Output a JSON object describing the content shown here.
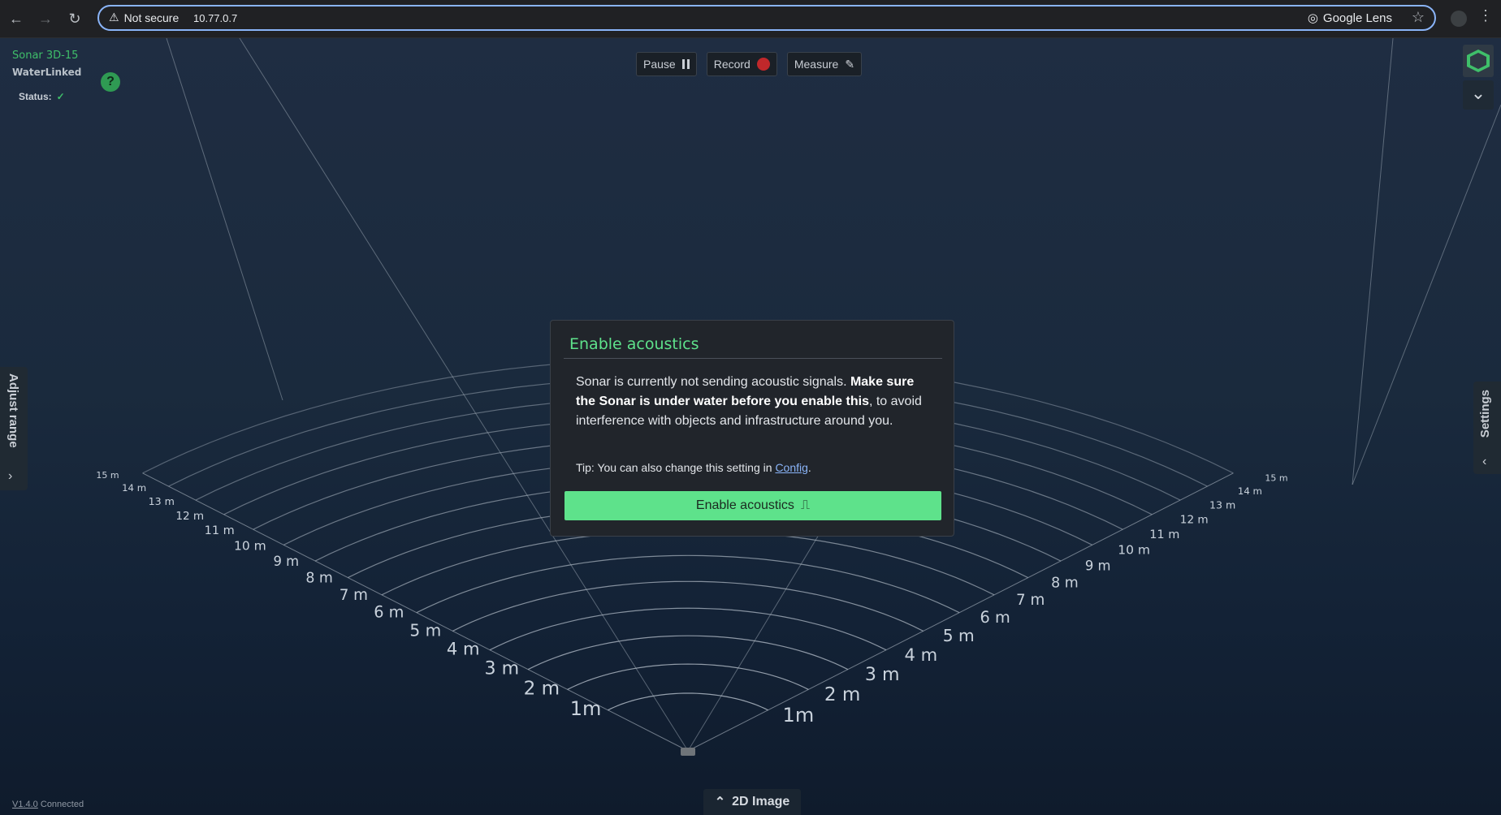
{
  "browser": {
    "security_label": "Not secure",
    "url": "10.77.0.7",
    "lens_label": "Google Lens"
  },
  "app": {
    "product": "Sonar 3D-15",
    "company": "WaterLinked",
    "status_label": "Status:",
    "help_label": "?",
    "version": "V1.4.0",
    "connection": "Connected"
  },
  "toolbar": {
    "pause_label": "Pause",
    "record_label": "Record",
    "measure_label": "Measure"
  },
  "side_panels": {
    "left_label": "Adjust range",
    "right_label": "Settings"
  },
  "bottom_tab": {
    "label": "2D Image"
  },
  "scene": {
    "left_range_labels": [
      "1m",
      "2 m",
      "3 m",
      "4 m",
      "5 m",
      "6 m",
      "7 m",
      "8 m",
      "9 m",
      "10 m",
      "11 m",
      "12 m",
      "13 m",
      "14 m",
      "15 m"
    ],
    "right_range_labels": [
      "1m",
      "2 m",
      "3 m",
      "4 m",
      "5 m",
      "6 m",
      "7 m",
      "8 m",
      "9 m",
      "10 m",
      "11 m",
      "12 m",
      "13 m",
      "14 m",
      "15 m"
    ]
  },
  "modal": {
    "title": "Enable acoustics",
    "body_prefix": "Sonar is currently not sending acoustic signals. ",
    "body_bold": "Make sure the Sonar is under water before you enable this",
    "body_suffix": ", to avoid interference with objects and infrastructure around you.",
    "tip_prefix": "Tip: You can also change this setting in ",
    "tip_link": "Config",
    "tip_suffix": ".",
    "button_label": "Enable acoustics"
  },
  "colors": {
    "accent": "#5ee28b",
    "brand_green": "#3fbf6a",
    "record_red": "#c0282b"
  }
}
